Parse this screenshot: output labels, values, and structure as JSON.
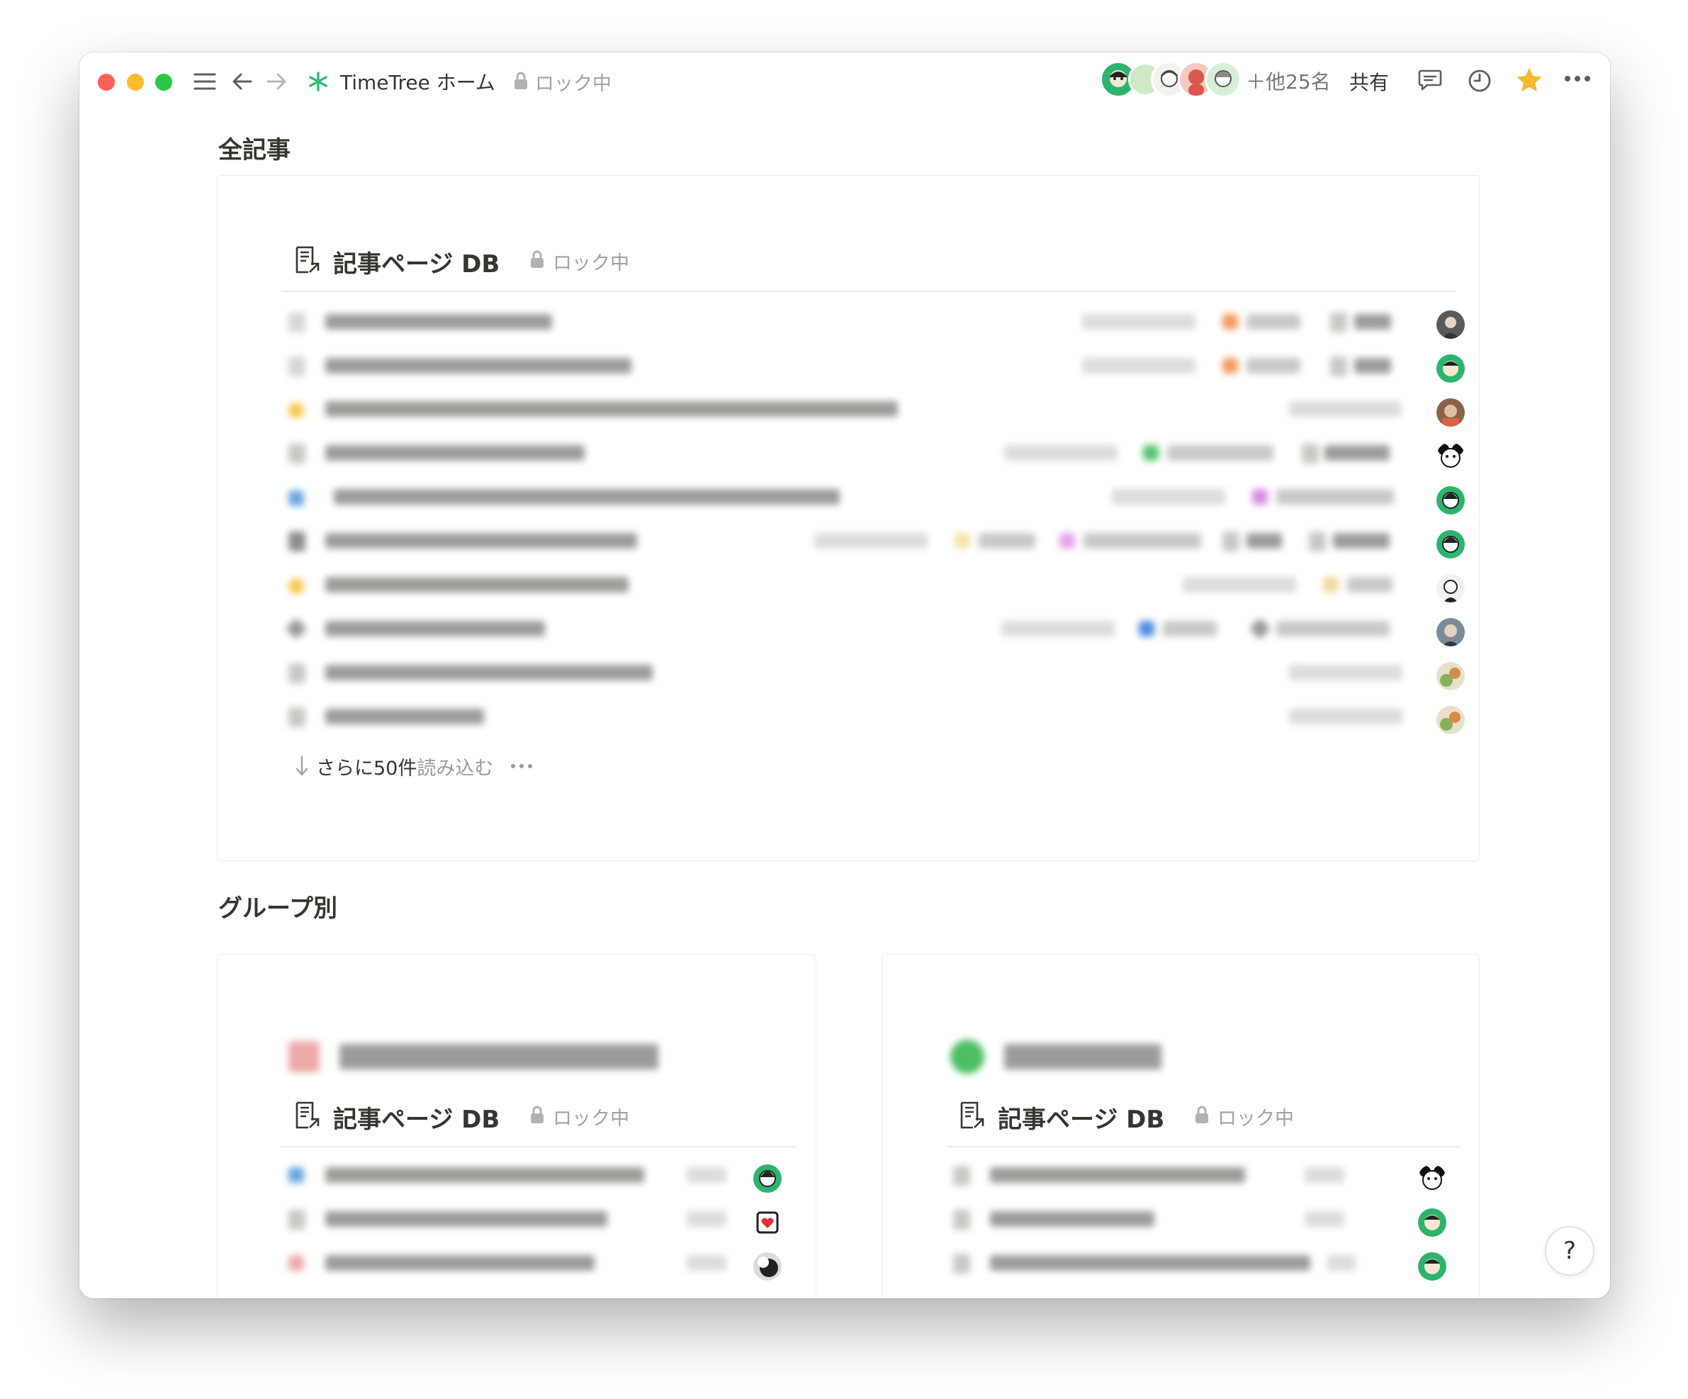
{
  "titlebar": {
    "page_title": "TimeTree ホーム",
    "lock_label": "ロック中",
    "others_label": "＋他25名",
    "share_label": "共有"
  },
  "main": {
    "all_articles_heading": "全記事",
    "by_group_heading": "グループ別",
    "db_title": "記事ページ DB",
    "lock_label": "ロック中",
    "load_more_count": "さらに50件",
    "load_more_label": "読み込む"
  },
  "help_label": "?",
  "colors": {
    "accent_star": "#f5b82e",
    "green_avatar": "#2db46c",
    "traffic_red": "#ff5f57",
    "traffic_yellow": "#febc2e",
    "traffic_green": "#28c840"
  },
  "icons": [
    "sidebar-toggle-icon",
    "back-arrow-icon",
    "forward-arrow-icon",
    "timetree-logo-icon",
    "lock-icon",
    "comment-icon",
    "history-clock-icon",
    "favorite-star-icon",
    "more-dots-icon",
    "database-page-icon",
    "down-arrow-icon",
    "help-icon"
  ]
}
